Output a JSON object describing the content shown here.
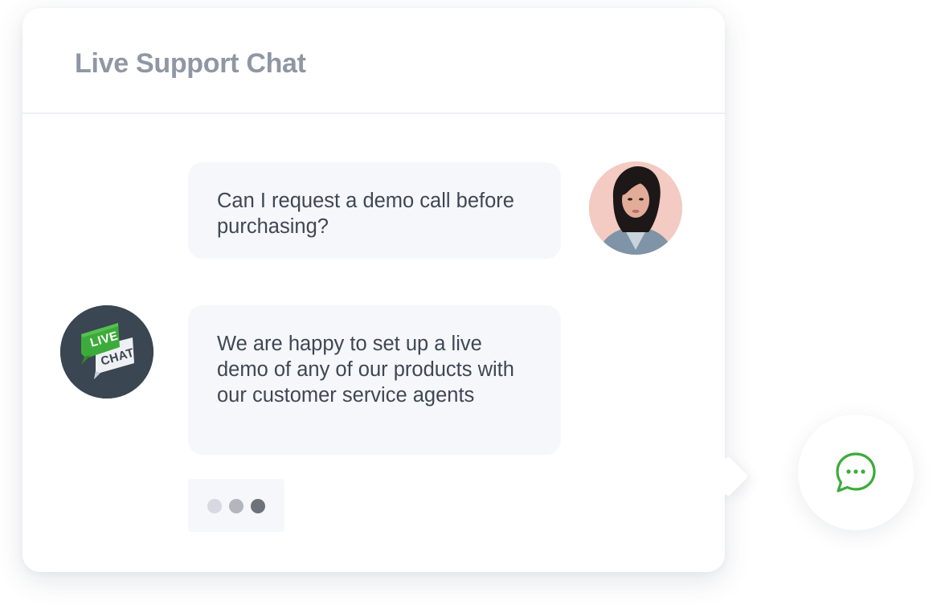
{
  "header": {
    "title": "Live Support Chat"
  },
  "messages": [
    {
      "sender": "user",
      "text": "Can I request a demo call before purchasing?",
      "avatar_icon": "user-avatar"
    },
    {
      "sender": "agent",
      "text": "We are happy to set up a live demo of any of our products with our customer service agents",
      "avatar_icon": "live-chat-logo"
    }
  ],
  "agent_logo": {
    "line1": "LIVE",
    "line2": "CHAT"
  },
  "typing_indicator": {
    "dots": 3
  },
  "launcher": {
    "icon": "chat-bubble-icon"
  },
  "colors": {
    "accent_green": "#3dab3b",
    "title_gray": "#8e97a3",
    "bubble_bg": "#f5f7fb",
    "text_dark": "#3f4754",
    "agent_avatar_bg": "#3a4652"
  }
}
